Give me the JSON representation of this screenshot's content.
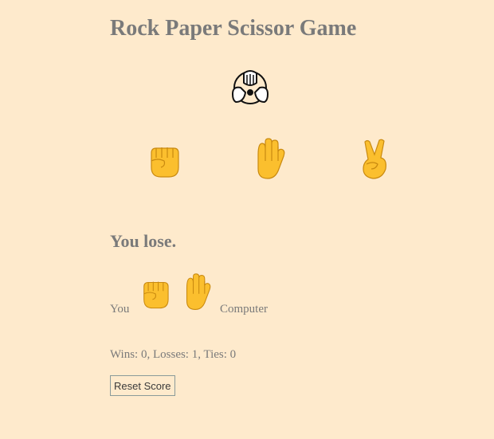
{
  "title": "Rock Paper Scissor Game",
  "logo_icon": "rock-paper-scissors-hands-icon",
  "choices": [
    {
      "name": "rock",
      "icon": "rock-fist-icon"
    },
    {
      "name": "paper",
      "icon": "paper-hand-icon"
    },
    {
      "name": "scissors",
      "icon": "scissors-hand-icon"
    }
  ],
  "result": {
    "text": "You lose."
  },
  "moves": {
    "you_label": "You",
    "you_move": "rock",
    "computer_label": "Computer",
    "computer_move": "paper"
  },
  "score": {
    "text": "Wins: 0, Losses: 1, Ties: 0"
  },
  "reset_label": "Reset Score",
  "colors": {
    "background": "#feeacc",
    "text": "#7a7a7a",
    "emoji_fill": "#fbbf2e",
    "emoji_shade": "#e8a317"
  }
}
